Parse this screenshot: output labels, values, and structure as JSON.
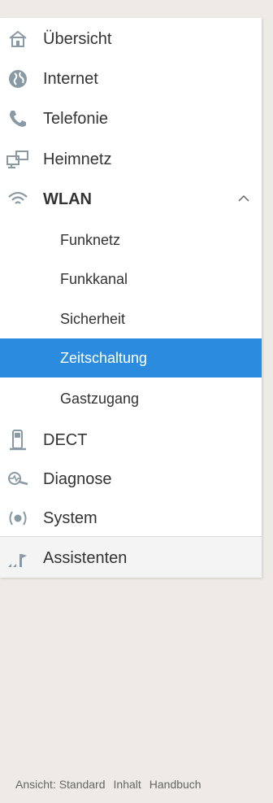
{
  "menu": {
    "items": [
      {
        "label": "Übersicht",
        "icon": "home-icon"
      },
      {
        "label": "Internet",
        "icon": "globe-icon"
      },
      {
        "label": "Telefonie",
        "icon": "phone-icon"
      },
      {
        "label": "Heimnetz",
        "icon": "network-icon"
      },
      {
        "label": "WLAN",
        "icon": "wifi-icon",
        "expanded": true
      },
      {
        "label": "DECT",
        "icon": "dect-phone-icon"
      },
      {
        "label": "Diagnose",
        "icon": "diagnosis-icon"
      },
      {
        "label": "System",
        "icon": "system-icon"
      },
      {
        "label": "Assistenten",
        "icon": "wizard-icon"
      }
    ],
    "wlan_subitems": [
      {
        "label": "Funknetz"
      },
      {
        "label": "Funkkanal"
      },
      {
        "label": "Sicherheit"
      },
      {
        "label": "Zeitschaltung",
        "active": true
      },
      {
        "label": "Gastzugang"
      }
    ]
  },
  "footer": {
    "view": "Ansicht: Standard",
    "contents": "Inhalt",
    "manual": "Handbuch"
  },
  "colors": {
    "accent": "#2b8bde",
    "background": "#eeebe6",
    "icon": "#8a9aa5"
  }
}
